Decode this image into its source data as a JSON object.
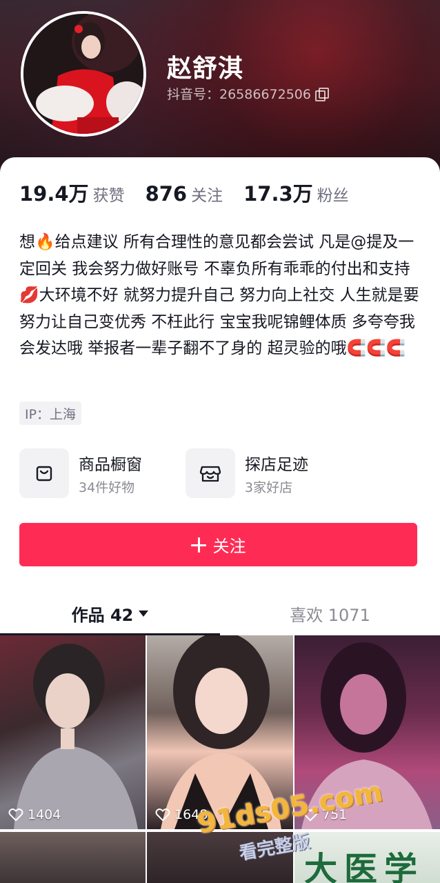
{
  "profile": {
    "display_name": "赵舒淇",
    "account_id": "抖音号：26586672506"
  },
  "stats": [
    {
      "value": "19.4万",
      "label": "获赞"
    },
    {
      "value": "876",
      "label": "关注"
    },
    {
      "value": "17.3万",
      "label": "粉丝"
    }
  ],
  "bio": "想🔥给点建议 所有合理性的意见都会尝试 凡是@提及一定回关 我会努力做好账号 不辜负所有乖乖的付出和支持💋大环境不好 就努力提升自己 努力向上社交 人生就是要努力让自己变优秀 不枉此行 宝宝我呢锦鲤体质 多夸夸我会发达哦 举报者一辈子翻不了身的 超灵验的哦🧲🧲🧲",
  "ip_tag": "IP：上海",
  "features": {
    "shop": {
      "title": "商品橱窗",
      "sub": "34件好物",
      "icon": "shopping-bag-icon"
    },
    "visits": {
      "title": "探店足迹",
      "sub": "3家好店",
      "icon": "storefront-icon"
    }
  },
  "follow_button": {
    "label": "关注",
    "color": "#fe2c55"
  },
  "tabs": {
    "works": "作品 42",
    "likes": "喜欢 1071"
  },
  "videos": [
    {
      "likes": "1404"
    },
    {
      "likes": "1648"
    },
    {
      "likes": "751"
    }
  ],
  "thumb6_text": "大医学",
  "watermark": {
    "main": "91ds05.com",
    "sub": "看完整版"
  }
}
